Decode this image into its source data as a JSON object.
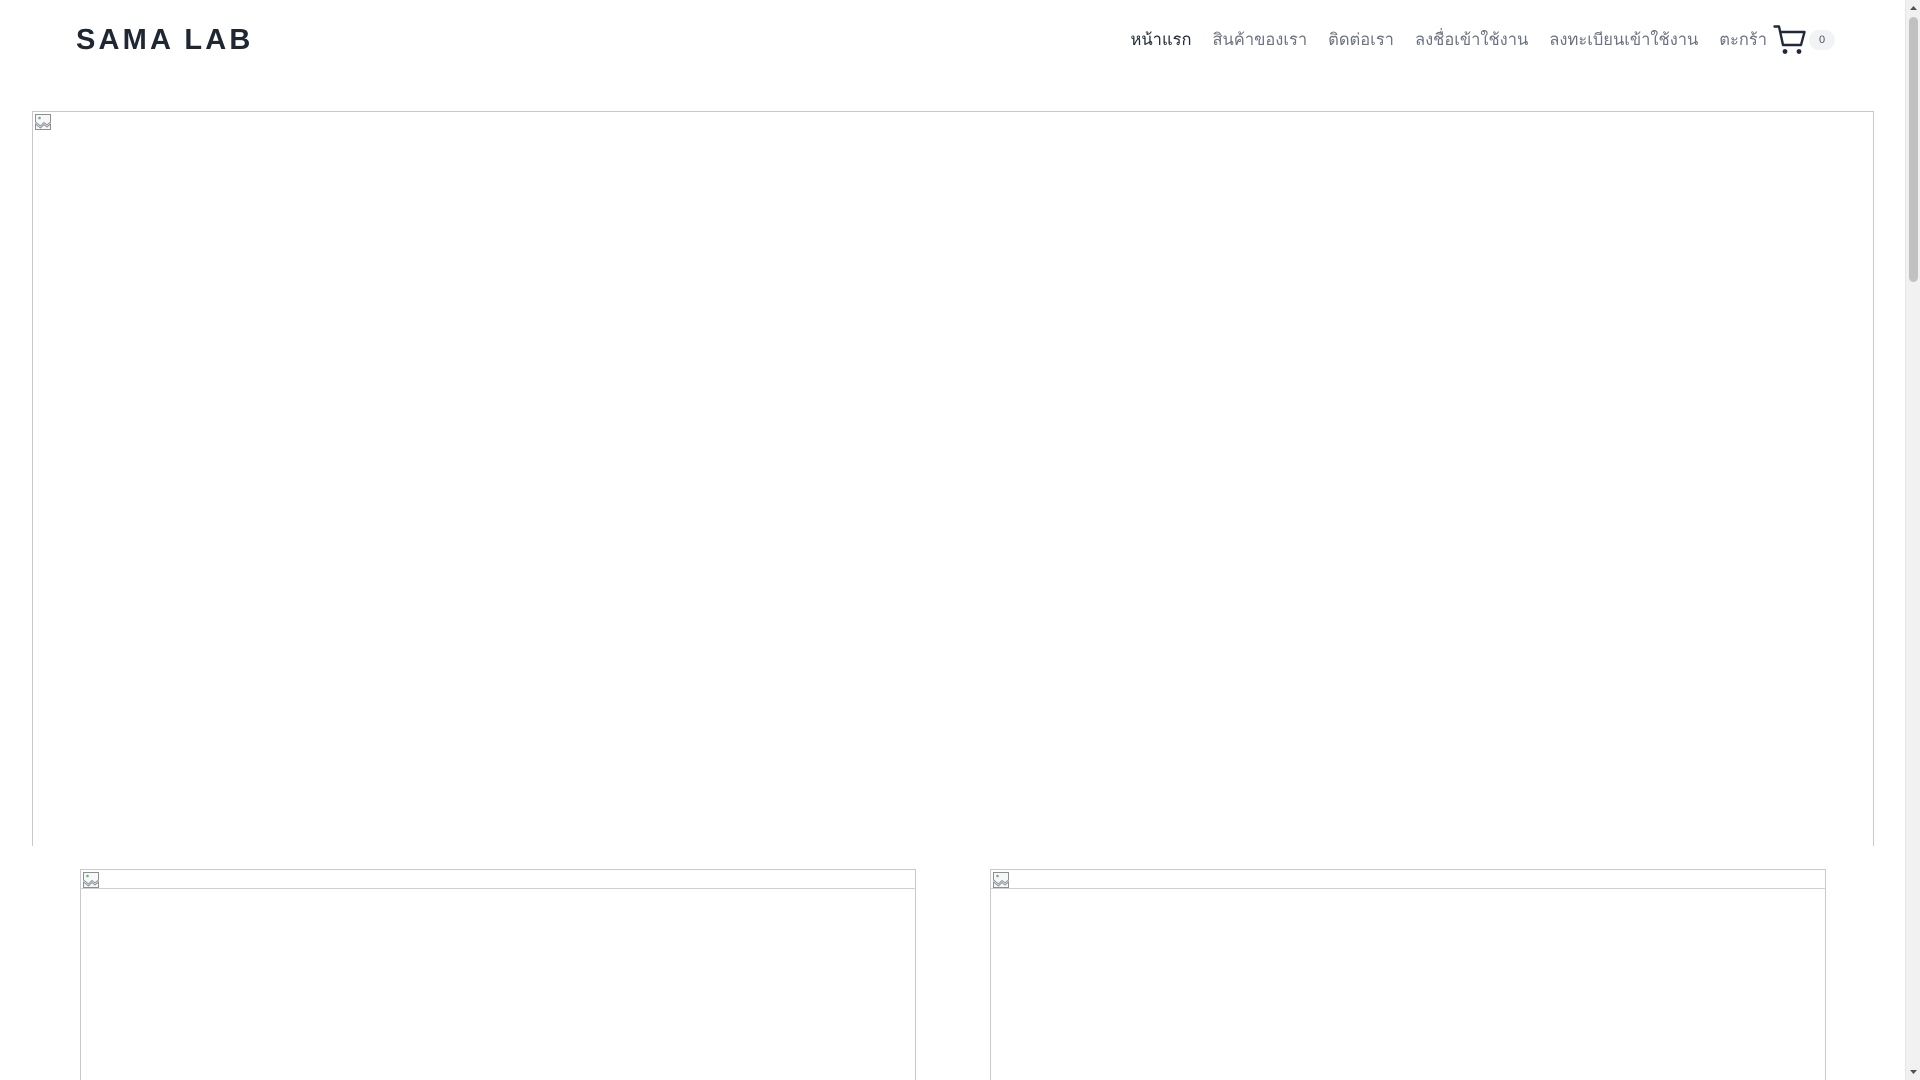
{
  "site": {
    "logo": "SAMA LAB"
  },
  "nav": {
    "items": [
      {
        "label": "หน้าแรก",
        "active": true
      },
      {
        "label": "สินค้าของเรา",
        "active": false
      },
      {
        "label": "ติดต่อเรา",
        "active": false
      },
      {
        "label": "ลงชื่อเข้าใช้งาน",
        "active": false
      },
      {
        "label": "ลงทะเบียนเข้าใช้งาน",
        "active": false
      }
    ],
    "cart": {
      "label": "ตะกร้า",
      "count": "0",
      "icon": "shopping-cart-icon"
    }
  },
  "images": {
    "hero_icon": "broken-image-icon",
    "thumb_left_icon": "broken-image-icon",
    "thumb_right_icon": "broken-image-icon"
  },
  "colors": {
    "text_primary": "#1f2937",
    "text_muted": "#6b7280",
    "logo": "#1f2733",
    "badge_bg": "#f1f3f5",
    "placeholder_border": "#c9c9c9",
    "scrollbar_track": "#f1f1f1",
    "scrollbar_thumb": "#c1c1c1"
  }
}
